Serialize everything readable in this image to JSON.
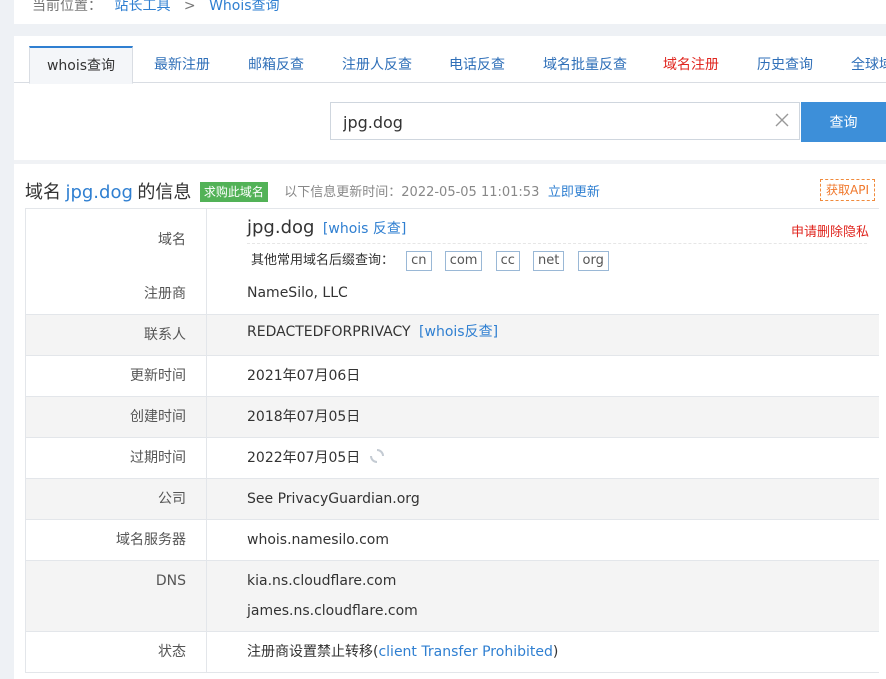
{
  "breadcrumb": {
    "prefix": "当前位置：",
    "items": [
      "站长工具",
      "Whois查询"
    ],
    "separator": ">"
  },
  "tabs": [
    {
      "label": "whois查询",
      "active": true
    },
    {
      "label": "最新注册"
    },
    {
      "label": "邮箱反查"
    },
    {
      "label": "注册人反查"
    },
    {
      "label": "电话反查"
    },
    {
      "label": "域名批量反查"
    },
    {
      "label": "域名注册",
      "color": "#e0261f"
    },
    {
      "label": "历史查询"
    },
    {
      "label": "全球域"
    }
  ],
  "search": {
    "value": "jpg.dog",
    "button_label": "查询"
  },
  "info": {
    "title_prefix": "域名",
    "domain": "jpg.dog",
    "title_suffix": "的信息",
    "buy_badge": "求购此域名",
    "update_text": "以下信息更新时间：2022-05-05 11:01:53",
    "update_link": "立即更新",
    "api_button": "获取API"
  },
  "table": {
    "domain_row": {
      "label": "域名",
      "domain": "jpg.dog",
      "whois_link": "[whois 反查]",
      "privacy_link": "申请删除隐私",
      "suffix_label": "其他常用域名后缀查询：",
      "suffixes": [
        "cn",
        "com",
        "cc",
        "net",
        "org"
      ]
    },
    "registrar": {
      "label": "注册商",
      "value": "NameSilo, LLC"
    },
    "contact": {
      "label": "联系人",
      "value": "REDACTEDFORPRIVACY",
      "link": "[whois反查]"
    },
    "updated": {
      "label": "更新时间",
      "value": "2021年07月06日"
    },
    "created": {
      "label": "创建时间",
      "value": "2018年07月05日"
    },
    "expires": {
      "label": "过期时间",
      "value": "2022年07月05日"
    },
    "company": {
      "label": "公司",
      "value": "See PrivacyGuardian.org"
    },
    "whois_server": {
      "label": "域名服务器",
      "value": "whois.namesilo.com"
    },
    "dns": {
      "label": "DNS",
      "values": [
        "kia.ns.cloudflare.com",
        "james.ns.cloudflare.com"
      ]
    },
    "status": {
      "label": "状态",
      "prefix": "注册商设置禁止转移(",
      "link": "client Transfer Prohibited",
      "suffix": ")"
    }
  },
  "colors": {
    "accent": "#2f7fd1",
    "red": "#e0261f",
    "badge_green": "#52b257",
    "search_button": "#3d8fd9"
  }
}
